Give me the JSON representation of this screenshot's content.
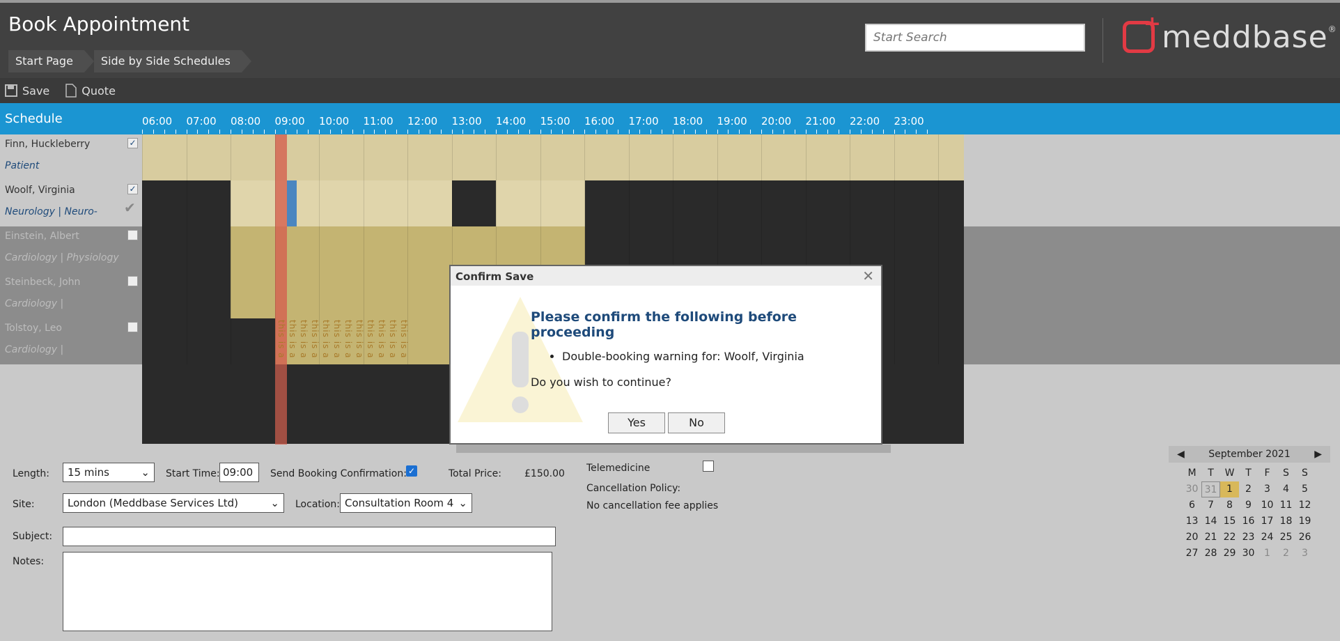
{
  "header": {
    "title": "Book Appointment",
    "breadcrumbs": [
      "Start Page",
      "Side by Side Schedules"
    ],
    "search_placeholder": "Start Search",
    "logo_text": "meddbase",
    "logo_mark": "®"
  },
  "toolbar": {
    "save_label": "Save",
    "quote_label": "Quote"
  },
  "schedule": {
    "label": "Schedule",
    "hours": [
      "06:00",
      "07:00",
      "08:00",
      "09:00",
      "10:00",
      "11:00",
      "12:00",
      "13:00",
      "14:00",
      "15:00",
      "16:00",
      "17:00",
      "18:00",
      "19:00",
      "20:00",
      "21:00",
      "22:00",
      "23:00"
    ],
    "resources": [
      {
        "name": "Finn, Huckleberry",
        "detail": "Patient",
        "checked": true
      },
      {
        "name": "Woolf, Virginia",
        "detail": "Neurology | Neuro-",
        "checked": true
      },
      {
        "name": "Einstein, Albert",
        "detail": "Cardiology | Physiology",
        "checked": false
      },
      {
        "name": "Steinbeck, John",
        "detail": "Cardiology |",
        "checked": false
      },
      {
        "name": "Tolstoy, Leo",
        "detail": "Cardiology |",
        "checked": false
      }
    ],
    "vertical_text": "this is a"
  },
  "dialog": {
    "title": "Confirm Save",
    "heading": "Please confirm the following before proceeding",
    "item": "Double-booking warning for: Woolf, Virginia",
    "question": "Do you wish to continue?",
    "yes": "Yes",
    "no": "No"
  },
  "form": {
    "length_label": "Length:",
    "length_value": "15 mins",
    "start_time_label": "Start Time:",
    "start_time_value": "09:00",
    "send_confirmation_label": "Send Booking Confirmation:",
    "send_confirmation_checked": true,
    "total_price_label": "Total Price:",
    "total_price_value": "£150.00",
    "telemedicine_label": "Telemedicine",
    "telemedicine_checked": false,
    "cancellation_policy_label": "Cancellation Policy:",
    "cancellation_policy_value": "No cancellation fee applies",
    "site_label": "Site:",
    "site_value": "London (Meddbase Services Ltd)",
    "location_label": "Location:",
    "location_value": "Consultation Room 4",
    "subject_label": "Subject:",
    "notes_label": "Notes:"
  },
  "calendar": {
    "month": "September 2021",
    "prev": "◀",
    "next": "▶",
    "weekdays": [
      "M",
      "T",
      "W",
      "T",
      "F",
      "S",
      "S"
    ],
    "days": [
      "30",
      "31",
      "1",
      "2",
      "3",
      "4",
      "5",
      "6",
      "7",
      "8",
      "9",
      "10",
      "11",
      "12",
      "13",
      "14",
      "15",
      "16",
      "17",
      "18",
      "19",
      "20",
      "21",
      "22",
      "23",
      "24",
      "25",
      "26",
      "27",
      "28",
      "29",
      "30",
      "1",
      "2",
      "3"
    ]
  },
  "colors": {
    "header_bg": "#414141",
    "schedule_bar": "#1b95d2",
    "available": "#d8cc9f",
    "blocked": "#2a2a2a",
    "highlight_red": "#d4604f",
    "booking_blue": "#4a86c0",
    "dialog_heading": "#1e4a7a",
    "logo_red": "#e23a44"
  }
}
